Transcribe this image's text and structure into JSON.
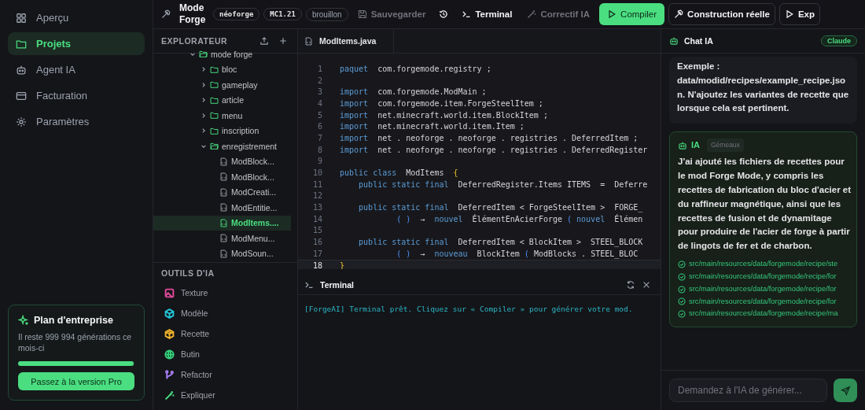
{
  "nav": {
    "items": [
      {
        "label": "Aperçu",
        "selected": false
      },
      {
        "label": "Projets",
        "selected": true
      },
      {
        "label": "Agent IA",
        "selected": false
      },
      {
        "label": "Facturation",
        "selected": false
      },
      {
        "label": "Paramètres",
        "selected": false
      }
    ],
    "plan": {
      "title": "Plan d'entreprise",
      "text": "Il reste 999 994 générations ce mois-ci",
      "level": 0.99,
      "button": "Passez à la version Pro"
    }
  },
  "toolbar": {
    "project": "Mode Forge",
    "badges": [
      {
        "label": "néoforge",
        "kind": "mono"
      },
      {
        "label": "MC1.21",
        "kind": "mono"
      },
      {
        "label": "brouillon",
        "kind": "status"
      }
    ],
    "buttons": [
      {
        "label": "Sauvegarder",
        "kind": "ghost",
        "disabled": true
      },
      {
        "kind": "icon",
        "disabled": false
      },
      {
        "label": "Terminal",
        "kind": "ghost",
        "disabled": false
      },
      {
        "label": "Correctif IA",
        "kind": "ghost",
        "disabled": true
      },
      {
        "label": "Compiler",
        "kind": "primary",
        "disabled": false
      },
      {
        "label": "Construction réelle",
        "kind": "outline",
        "disabled": false
      },
      {
        "label": "Exp",
        "kind": "outline",
        "disabled": false
      }
    ]
  },
  "explorer": {
    "title": "EXPLORATEUR",
    "tree": [
      {
        "label": "mode forge",
        "kind": "folder",
        "expanded": true,
        "selected": false,
        "children": [
          {
            "label": "bloc",
            "kind": "folder",
            "expanded": false,
            "selected": false
          },
          {
            "label": "gameplay",
            "kind": "folder",
            "expanded": false,
            "selected": false
          },
          {
            "label": "article",
            "kind": "folder",
            "expanded": false,
            "selected": false
          },
          {
            "label": "menu",
            "kind": "folder",
            "expanded": false,
            "selected": false
          },
          {
            "label": "inscription",
            "kind": "folder",
            "expanded": false,
            "selected": false
          },
          {
            "label": "enregistrement",
            "kind": "folder",
            "expanded": true,
            "selected": false,
            "children": [
              {
                "label": "ModBlock...",
                "kind": "file",
                "selected": false
              },
              {
                "label": "ModBlock...",
                "kind": "file",
                "selected": false
              },
              {
                "label": "ModCreati...",
                "kind": "file",
                "selected": false
              },
              {
                "label": "ModEntitie...",
                "kind": "file",
                "selected": false
              },
              {
                "label": "ModItems....",
                "kind": "file",
                "selected": true
              },
              {
                "label": "ModMenu...",
                "kind": "file",
                "selected": false
              },
              {
                "label": "ModSoun...",
                "kind": "file",
                "selected": false
              }
            ]
          }
        ]
      }
    ]
  },
  "ai_tools": {
    "title": "OUTILS D'IA",
    "items": [
      {
        "label": "Texture",
        "color": "#e24a9a"
      },
      {
        "label": "Modèle",
        "color": "#22c5d8"
      },
      {
        "label": "Recette",
        "color": "#f0b429"
      },
      {
        "label": "Butin",
        "color": "#34d27b"
      },
      {
        "label": "Refactor",
        "color": "#a57cf0"
      },
      {
        "label": "Expliquer",
        "color": "#4ade80"
      }
    ]
  },
  "editor": {
    "tab": "ModItems.java",
    "lines": [
      {
        "n": "1",
        "active": false,
        "tokens": [
          {
            "kind": "kw",
            "t": "paquet"
          },
          {
            "kind": "id",
            "t": "  com.forgemode.registry ;"
          }
        ]
      },
      {
        "n": "2",
        "active": false
      },
      {
        "n": "3",
        "active": false,
        "tokens": [
          {
            "kind": "kw",
            "t": "import"
          },
          {
            "kind": "id",
            "t": "  com.forgemode.ModMain ;"
          }
        ]
      },
      {
        "n": "4",
        "active": false,
        "tokens": [
          {
            "kind": "kw",
            "t": "import"
          },
          {
            "kind": "id",
            "t": "  com.forgemode.item.ForgeSteelItem ;"
          }
        ]
      },
      {
        "n": "5",
        "active": false,
        "tokens": [
          {
            "kind": "kw",
            "t": "import"
          },
          {
            "kind": "id",
            "t": "  net.minecraft.world.item.BlockItem ;"
          }
        ]
      },
      {
        "n": "6",
        "active": false,
        "tokens": [
          {
            "kind": "kw",
            "t": "import"
          },
          {
            "kind": "id",
            "t": "  net.minecraft.world.item.Item ;"
          }
        ]
      },
      {
        "n": "7",
        "active": false,
        "tokens": [
          {
            "kind": "kw",
            "t": "import"
          },
          {
            "kind": "id",
            "t": "  net . neoforge . neoforge . registries . DeferredItem ;"
          }
        ]
      },
      {
        "n": "8",
        "active": false,
        "tokens": [
          {
            "kind": "kw",
            "t": "import"
          },
          {
            "kind": "id",
            "t": "  net . neoforge . neoforge . registries . DeferredRegister"
          }
        ]
      },
      {
        "n": "9",
        "active": false
      },
      {
        "n": "10",
        "active": false,
        "tokens": [
          {
            "kind": "kw",
            "t": "public class"
          },
          {
            "kind": "id",
            "t": "  ModItems  "
          },
          {
            "kind": "brace",
            "t": "{"
          }
        ]
      },
      {
        "n": "11",
        "active": false,
        "tokens": [
          {
            "kind": "kw",
            "t": "    public static final"
          },
          {
            "kind": "id",
            "t": "  DeferredRegister.Items ITEMS  =  Deferre"
          }
        ]
      },
      {
        "n": "12",
        "active": false
      },
      {
        "n": "13",
        "active": false,
        "tokens": [
          {
            "kind": "kw",
            "t": "    public static final"
          },
          {
            "kind": "id",
            "t": "  DeferredItem < ForgeSteelItem >  FORGE_"
          }
        ]
      },
      {
        "n": "14",
        "active": false,
        "tokens": [
          {
            "kind": "paren",
            "t": "            ( )"
          },
          {
            "kind": "id",
            "t": "  →  "
          },
          {
            "kind": "kw",
            "t": "nouvel"
          },
          {
            "kind": "id",
            "t": "  ÉlémentEnAcierForge "
          },
          {
            "kind": "paren",
            "t": "("
          },
          {
            "kind": "kw",
            "t": " nouvel"
          },
          {
            "kind": "id",
            "t": "  Élémen"
          }
        ]
      },
      {
        "n": "15",
        "active": false
      },
      {
        "n": "16",
        "active": false,
        "tokens": [
          {
            "kind": "kw",
            "t": "    public static final"
          },
          {
            "kind": "id",
            "t": "  DeferredItem < BlockItem >  STEEL_BLOCK"
          }
        ]
      },
      {
        "n": "17",
        "active": false,
        "tokens": [
          {
            "kind": "paren",
            "t": "            ( )"
          },
          {
            "kind": "id",
            "t": "  →  "
          },
          {
            "kind": "kw",
            "t": "nouveau"
          },
          {
            "kind": "id",
            "t": "  BlockItem "
          },
          {
            "kind": "paren",
            "t": "("
          },
          {
            "kind": "id",
            "t": " ModBlocks . STEEL_BLOC"
          }
        ]
      },
      {
        "n": "18",
        "active": true,
        "tokens": [
          {
            "kind": "brace",
            "t": "}"
          }
        ]
      }
    ]
  },
  "terminal": {
    "title": "Terminal",
    "output": "[ForgeAI] Terminal prêt. Cliquez sur « Compiler » pour générer votre mod."
  },
  "chat": {
    "title": "Chat IA",
    "model": "Claude",
    "messages": [
      {
        "kind": "user",
        "text": "Exemple : data/modid/recipes/example_recipe.json. N'ajoutez les variantes de recette que lorsque cela est pertinent."
      },
      {
        "kind": "ai",
        "author": "IA",
        "tag": "Gémeaux",
        "text": "J'ai ajouté les fichiers de recettes pour le mod Forge Mode, y compris les recettes de fabrication du bloc d'acier et du raffineur magnétique, ainsi que les recettes de fusion et de dynamitage pour produire de l'acier de forge à partir de lingots de fer et de charbon.",
        "files": [
          "src/main/resources/data/forgemode/recipe/ste",
          "src/main/resources/data/forgemode/recipe/for",
          "src/main/resources/data/forgemode/recipe/for",
          "src/main/resources/data/forgemode/recipe/for",
          "src/main/resources/data/forgemode/recipe/ma"
        ]
      }
    ],
    "input": {
      "placeholder": "Demandez à l'IA de générer..."
    }
  }
}
